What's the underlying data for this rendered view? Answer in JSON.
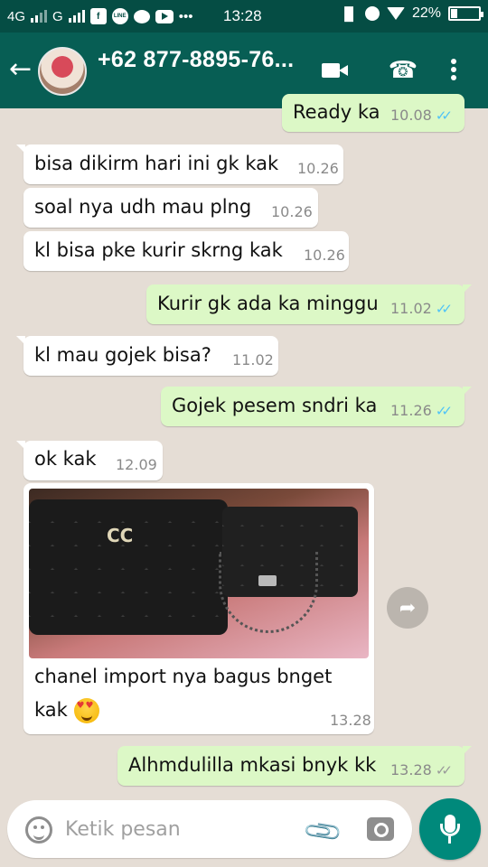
{
  "status_bar": {
    "net1": "4G",
    "net2": "G",
    "app_icon_fb": "f",
    "app_icon_line": "LINE",
    "more": "•••",
    "time": "13:28",
    "battery": "22%",
    "battery_level": 0.22
  },
  "header": {
    "contact": "+62 877-8895-76...",
    "back_glyph": "←",
    "call_glyph": "☎"
  },
  "messages": [
    {
      "text": "Ready ka",
      "time": "10.08",
      "dir": "out",
      "status": "read"
    },
    {
      "text": "bisa dikirm hari ini gk kak",
      "time": "10.26",
      "dir": "in"
    },
    {
      "text": "soal nya udh mau plng",
      "time": "10.26",
      "dir": "in"
    },
    {
      "text": "kl bisa pke kurir skrng kak",
      "time": "10.26",
      "dir": "in"
    },
    {
      "text": "Kurir gk ada ka minggu",
      "time": "11.02",
      "dir": "out",
      "status": "read"
    },
    {
      "text": "kl mau gojek bisa?",
      "time": "11.02",
      "dir": "in"
    },
    {
      "text": "Gojek pesem sndri ka",
      "time": "11.26",
      "dir": "out",
      "status": "read"
    },
    {
      "text": "ok kak",
      "time": "12.09",
      "dir": "in"
    },
    {
      "caption_line1": "chanel import nya bagus bnget",
      "caption_line2": "kak",
      "time": "13.28",
      "dir": "in",
      "type": "image"
    },
    {
      "text": "Alhmdulilla mkasi bnyk kk",
      "time": "13.28",
      "dir": "out",
      "status": "delivered"
    }
  ],
  "ticks_glyph": "✓✓",
  "share_glyph": "➦",
  "photo_logo": "CC",
  "input": {
    "placeholder": "Ketik pesan",
    "attach_glyph": "📎"
  },
  "colors": {
    "header": "#075e54",
    "status_bar": "#054d44",
    "outgoing": "#dcf8c6",
    "incoming": "#ffffff",
    "read_ticks": "#4fc3f7",
    "mic": "#00897b"
  }
}
